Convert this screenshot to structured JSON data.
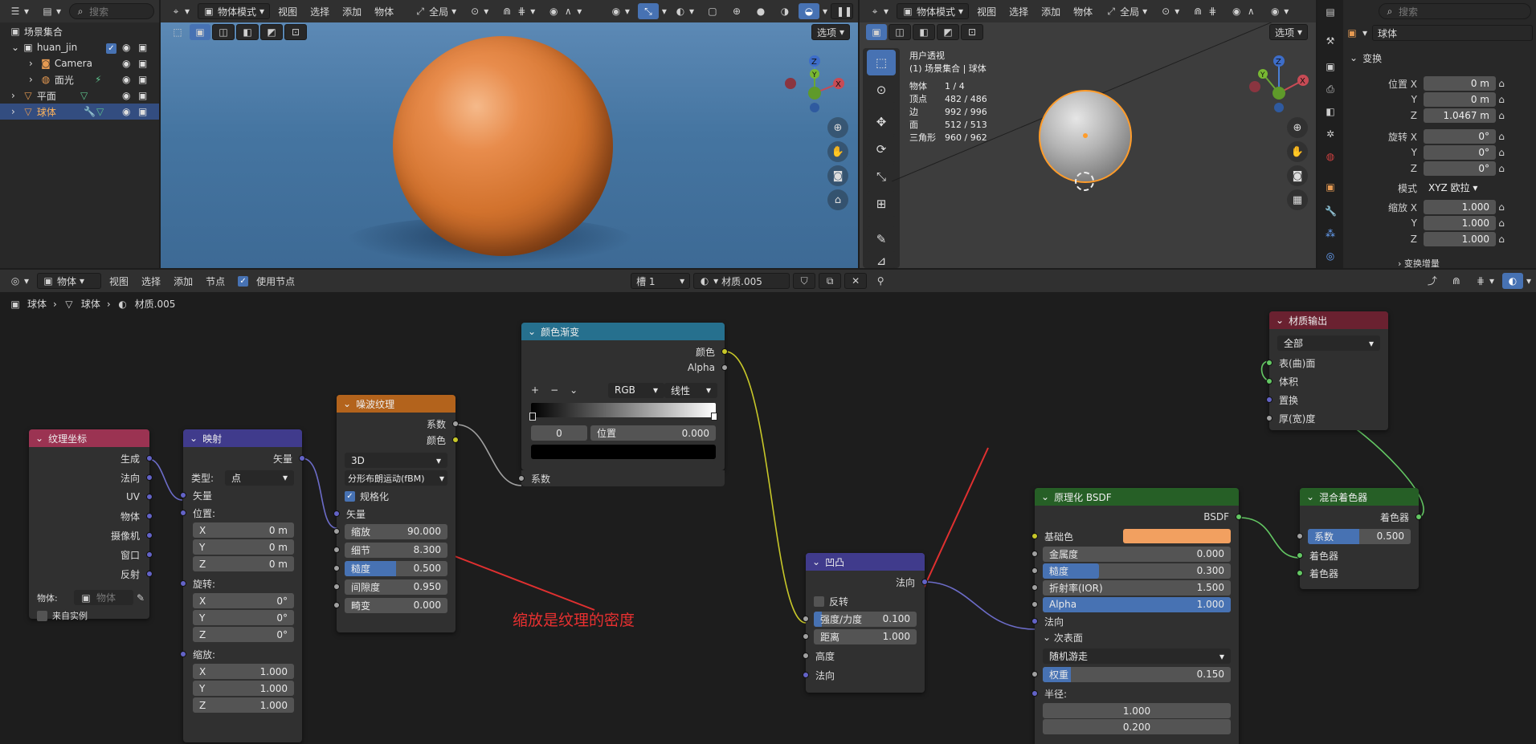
{
  "outliner": {
    "title": "场景集合",
    "search_placeholder": "搜索",
    "items": [
      {
        "label": "huan_jin",
        "indent": 1
      },
      {
        "label": "Camera",
        "indent": 2
      },
      {
        "label": "面光",
        "indent": 2
      },
      {
        "label": "平面",
        "indent": 1
      },
      {
        "label": "球体",
        "indent": 1,
        "selected": true
      }
    ]
  },
  "viewport_left": {
    "mode": "物体模式",
    "menus": [
      "视图",
      "选择",
      "添加",
      "物体"
    ],
    "global": "全局",
    "options": "选项"
  },
  "viewport_right": {
    "mode": "物体模式",
    "menus": [
      "视图",
      "选择",
      "添加",
      "物体"
    ],
    "global": "全局",
    "options": "选项",
    "view_name": "用户透视",
    "collection_path": "(1) 场景集合 | 球体",
    "stats": [
      {
        "k": "物体",
        "v": "1 / 4"
      },
      {
        "k": "顶点",
        "v": "482 / 486"
      },
      {
        "k": "边",
        "v": "992 / 996"
      },
      {
        "k": "面",
        "v": "512 / 513"
      },
      {
        "k": "三角形",
        "v": "960 / 962"
      }
    ]
  },
  "properties": {
    "search_placeholder": "搜索",
    "object_name": "球体",
    "section": "变换",
    "location_label": "位置 X",
    "location": [
      "0 m",
      "0 m",
      "1.0467 m"
    ],
    "rotation_label": "旋转 X",
    "rotation": [
      "0°",
      "0°",
      "0°"
    ],
    "mode_label": "模式",
    "mode_value": "XYZ 欧拉",
    "scale_label": "缩放 X",
    "scale": [
      "1.000",
      "1.000",
      "1.000"
    ],
    "y": "Y",
    "z": "Z",
    "delta": "变换增量"
  },
  "node_editor": {
    "header": {
      "object": "物体",
      "menus": [
        "视图",
        "选择",
        "添加",
        "节点"
      ],
      "use_nodes": "使用节点",
      "slot": "槽 1",
      "material": "材质.005"
    },
    "breadcrumb": [
      "球体",
      "球体",
      "材质.005"
    ],
    "annotation": "缩放是纹理的密度"
  },
  "nodes": {
    "texcoord": {
      "title": "纹理坐标",
      "outputs": [
        "生成",
        "法向",
        "UV",
        "物体",
        "摄像机",
        "窗口",
        "反射"
      ],
      "object_label": "物体:",
      "object_placeholder": "物体",
      "from_instancer": "来自实例"
    },
    "mapping": {
      "title": "映射",
      "out": "矢量",
      "type_label": "类型:",
      "type_value": "点",
      "vector": "矢量",
      "location": "位置:",
      "rotation": "旋转:",
      "scale": "缩放:",
      "loc": [
        "0 m",
        "0 m",
        "0 m"
      ],
      "rot": [
        "0°",
        "0°",
        "0°"
      ],
      "scl": [
        "1.000",
        "1.000",
        "1.000"
      ],
      "axes": [
        "X",
        "Y",
        "Z"
      ]
    },
    "noise": {
      "title": "噪波纹理",
      "out": [
        "系数",
        "颜色"
      ],
      "dim": "3D",
      "type": "分形布朗运动(fBM)",
      "normalize": "规格化",
      "vector": "矢量",
      "fields": [
        {
          "k": "缩放",
          "v": "90.000"
        },
        {
          "k": "细节",
          "v": "8.300"
        },
        {
          "k": "糙度",
          "v": "0.500",
          "fill": 0.5
        },
        {
          "k": "间隙度",
          "v": "0.950"
        },
        {
          "k": "畸变",
          "v": "0.000"
        }
      ]
    },
    "ramp": {
      "title": "颜色渐变",
      "out": [
        "颜色",
        "Alpha"
      ],
      "mode": "RGB",
      "interp": "线性",
      "index": "0",
      "pos_label": "位置",
      "pos_value": "0.000",
      "fac": "系数"
    },
    "bump": {
      "title": "凹凸",
      "out": "法向",
      "invert": "反转",
      "strength": "强度/力度",
      "strength_v": "0.100",
      "distance": "距离",
      "distance_v": "1.000",
      "height": "高度",
      "normal": "法向"
    },
    "bsdf": {
      "title": "原理化 BSDF",
      "out": "BSDF",
      "base": "基础色",
      "base_color": "#f2a060",
      "fields": [
        {
          "k": "金属度",
          "v": "0.000"
        },
        {
          "k": "糙度",
          "v": "0.300",
          "fill": 0.3
        },
        {
          "k": "折射率(IOR)",
          "v": "1.500"
        },
        {
          "k": "Alpha",
          "v": "1.000",
          "fill": 1
        }
      ],
      "normal": "法向",
      "subsurface": "次表面",
      "ss_method": "随机游走",
      "weight": "权重",
      "weight_v": "0.150",
      "radius": "半径:",
      "r1": "1.000",
      "r2": "0.200"
    },
    "mix": {
      "title": "混合着色器",
      "out": "着色器",
      "fac": "系数",
      "fac_v": "0.500",
      "in1": "着色器",
      "in2": "着色器"
    },
    "output": {
      "title": "材质输出",
      "target": "全部",
      "inputs": [
        "表(曲)面",
        "体积",
        "置换",
        "厚(宽)度"
      ]
    }
  },
  "colors": {
    "accent": "#4772b3",
    "texcoord": "#9b3352",
    "mapping": "#403b8c",
    "noise": "#b3631c",
    "ramp": "#26708e",
    "bump": "#403b8c",
    "bsdf": "#265f26",
    "mix": "#265f26",
    "output": "#6a2130"
  }
}
